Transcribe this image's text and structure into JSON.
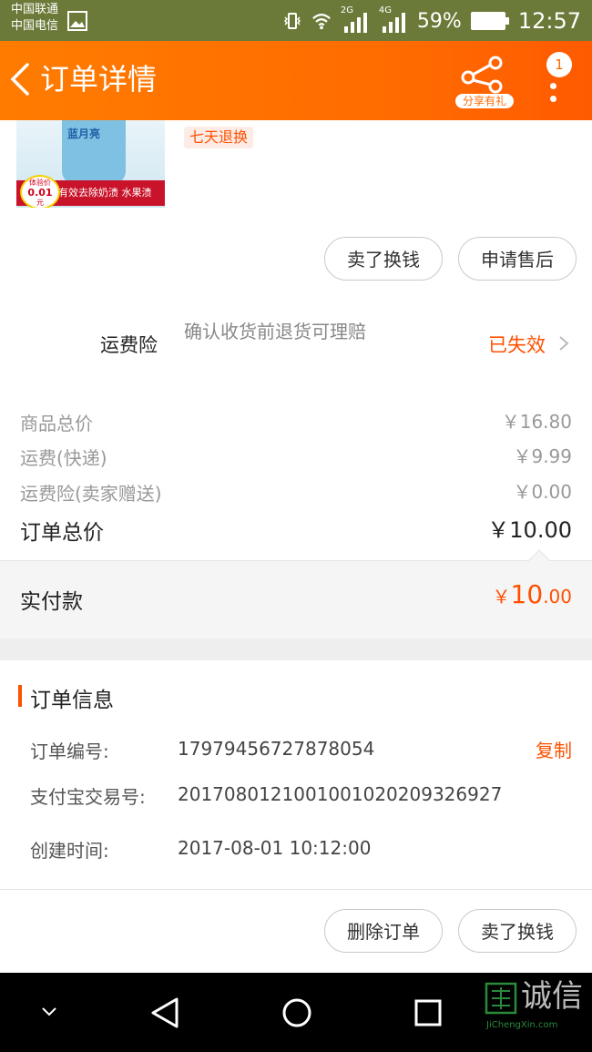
{
  "status_bar": {
    "carrier1": "中国联通",
    "carrier2": "中国电信",
    "battery": "59%",
    "time": "12:57",
    "net1": "2G",
    "net2": "4G"
  },
  "header": {
    "title": "订单详情",
    "share_label": "分享有礼",
    "badge": "1"
  },
  "product": {
    "brand": "蓝月亮",
    "promo_price": "0.01",
    "promo_label": "体验价",
    "promo_unit": "元",
    "strip_text": "有效去除奶渍 水果渍",
    "tag": "七天退换"
  },
  "actions_top": {
    "sell": "卖了换钱",
    "after_sale": "申请售后"
  },
  "insurance": {
    "label": "运费险",
    "desc": "确认收货前退货可理赔",
    "status": "已失效"
  },
  "price": {
    "rows": [
      {
        "label": "商品总价",
        "value": "￥16.80"
      },
      {
        "label": "运费(快递)",
        "value": "￥9.99"
      },
      {
        "label": "运费险(卖家赠送)",
        "value": "￥0.00"
      }
    ],
    "total_label": "订单总价",
    "total_value": "￥10.00",
    "paid_label": "实付款",
    "paid_symbol": "￥",
    "paid_int": "10",
    "paid_dec": ".00"
  },
  "order_info": {
    "title": "订单信息",
    "fields": [
      {
        "label": "订单编号:",
        "value": "17979456727878054"
      },
      {
        "label": "支付宝交易号:",
        "value": "2017080121001001020209326927"
      },
      {
        "label": "创建时间:",
        "value": "2017-08-01 10:12:00"
      }
    ],
    "copy_label": "复制"
  },
  "actions_bottom": {
    "delete": "删除订单",
    "sell": "卖了换钱"
  },
  "watermark": {
    "brand": "诚信",
    "site": "JiChengXin.com"
  },
  "colors": {
    "accent": "#ff5000",
    "header": "#ff6a00",
    "statusbar": "#6b7a38"
  }
}
